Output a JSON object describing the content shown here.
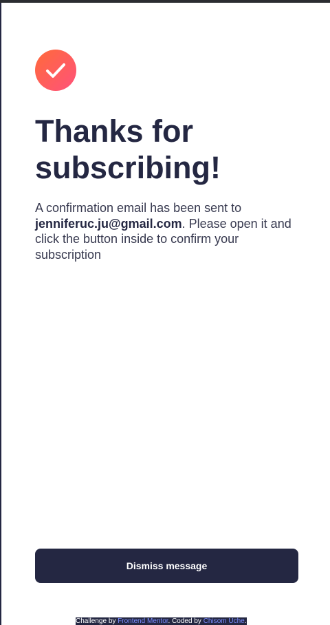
{
  "success": {
    "icon": "checkmark-icon",
    "title": "Thanks for subscribing!",
    "message_before_email": "A confirmation email has been sent to ",
    "email": "jenniferuc.ju@gmail.com",
    "message_after_email": ". Please open it and click the button inside to confirm your subscription",
    "dismiss_label": "Dismiss message"
  },
  "attribution": {
    "prefix": "Challenge by ",
    "challenge_link": "Frontend Mentor",
    "middle": ". Coded by ",
    "author_link": "Chisom Uche",
    "suffix": "."
  },
  "colors": {
    "dark_navy": "#242742",
    "text_gray": "#36384e",
    "gradient_start": "#ff6a3a",
    "gradient_end": "#ff527b",
    "link_blue": "#7b8cff"
  }
}
